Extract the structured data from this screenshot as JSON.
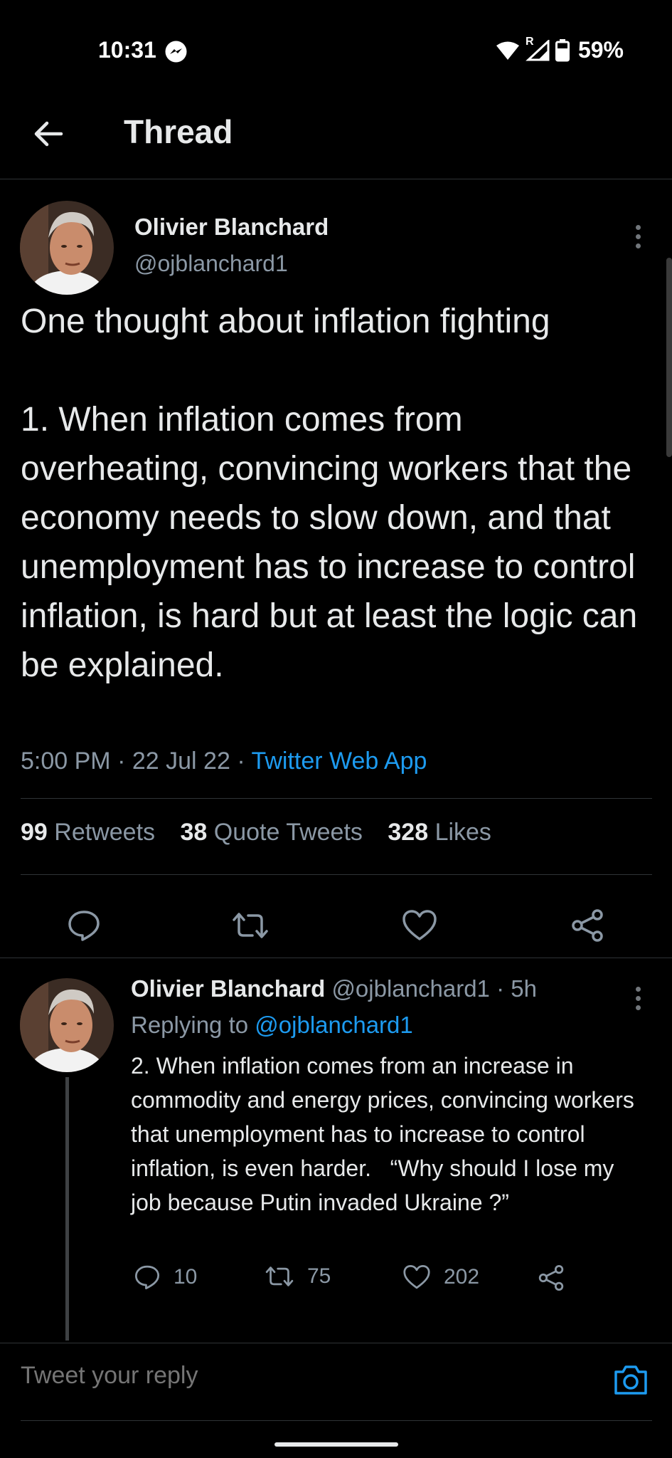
{
  "status_bar": {
    "time": "10:31",
    "battery": "59%",
    "roaming_label": "R"
  },
  "header": {
    "title": "Thread"
  },
  "main_tweet": {
    "author_name": "Olivier Blanchard",
    "author_handle": "@ojblanchard1",
    "text": "One thought about inflation fighting\n\n1. When inflation comes from overheating, convincing workers that the economy needs to slow down, and that unemployment has to increase to control inflation, is hard but at least the logic can be explained.",
    "time": "5:00 PM",
    "date": "22 Jul 22",
    "source": "Twitter Web App",
    "stats": {
      "retweets_count": "99",
      "retweets_label": "Retweets",
      "quotes_count": "38",
      "quotes_label": "Quote Tweets",
      "likes_count": "328",
      "likes_label": "Likes"
    }
  },
  "reply_tweet": {
    "author_name": "Olivier Blanchard",
    "author_handle": "@ojblanchard1",
    "age": "5h",
    "replying_prefix": "Replying to",
    "replying_to": "@ojblanchard1",
    "text": "2. When inflation comes from an increase in commodity and energy prices, convincing workers that unemployment has to increase to control inflation, is even harder.   “Why should I lose my job because Putin invaded Ukraine ?”",
    "replies": "10",
    "retweets": "75",
    "likes": "202"
  },
  "compose": {
    "placeholder": "Tweet your reply"
  },
  "colors": {
    "background": "#000000",
    "text": "#e7e9ea",
    "muted": "#8b98a5",
    "accent": "#1d9bf0",
    "divider": "#2f3336"
  }
}
